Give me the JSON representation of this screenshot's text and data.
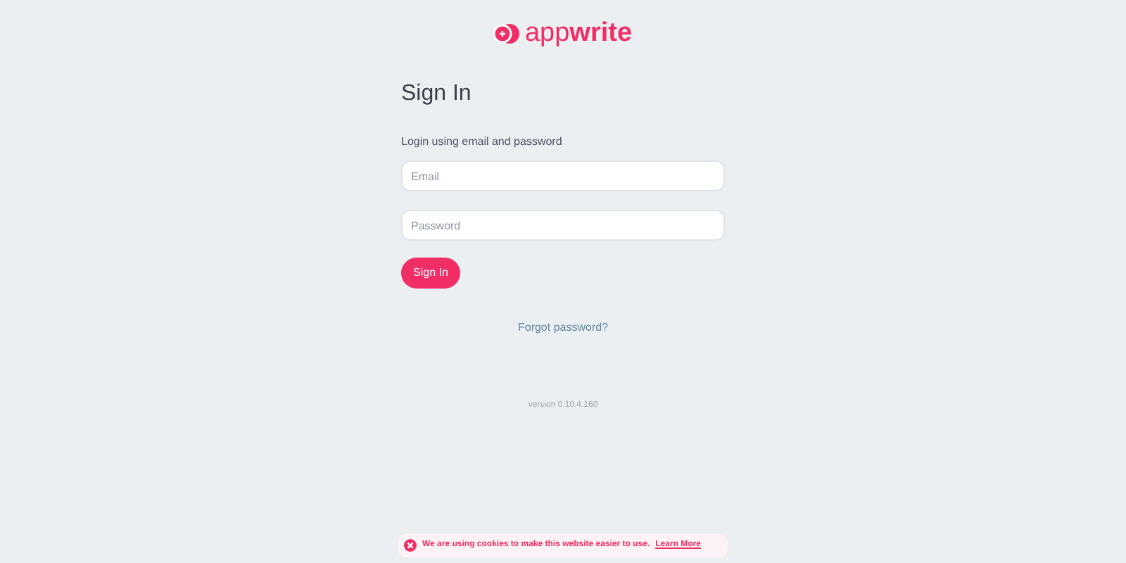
{
  "logo": {
    "text": "app**write**"
  },
  "title": "Sign In",
  "subtitle": "Login using email and password",
  "fields": [
    {
      "placeholder": "Email"
    },
    {
      "placeholder": "Password"
    }
  ],
  "submit": "Sign In",
  "forgot": "Forgot password?",
  "version": "version 0.10.4.160",
  "cookie": {
    "message": "We are using cookies to make this website easier to use.",
    "link": "Learn More"
  }
}
